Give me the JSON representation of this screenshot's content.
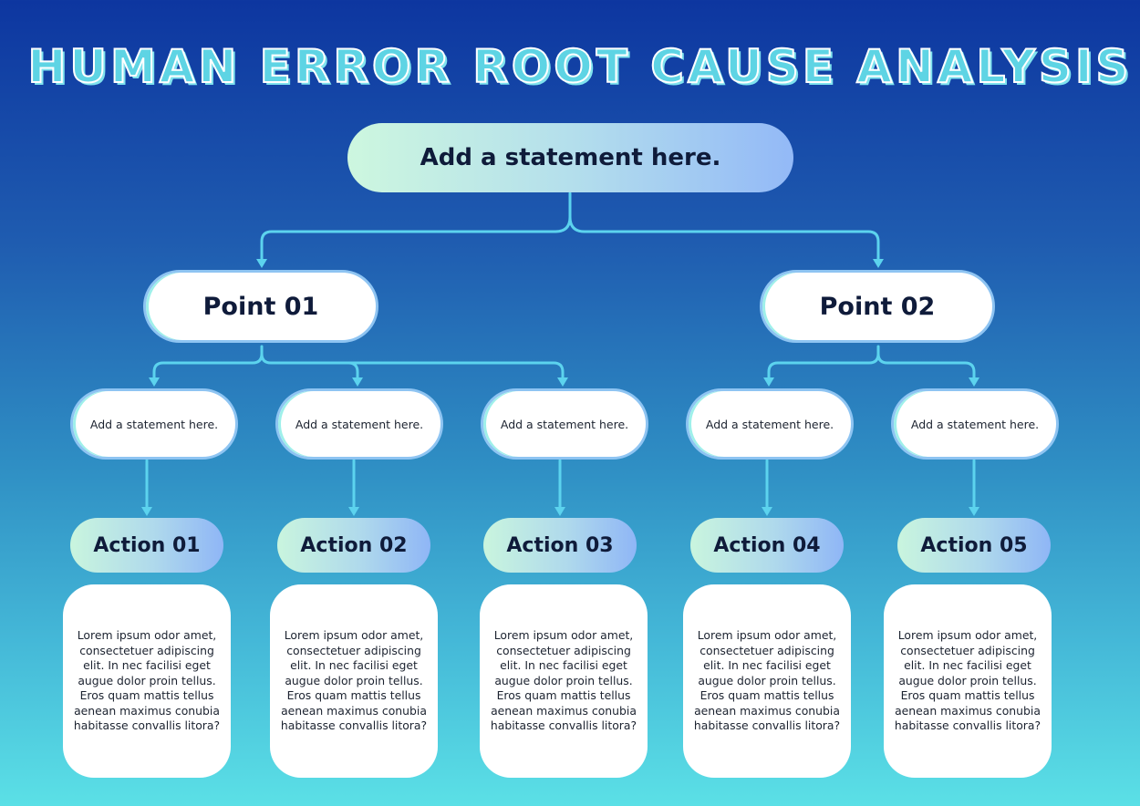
{
  "title": "HUMAN ERROR ROOT CAUSE ANALYSIS",
  "root": {
    "label": "Add a statement here."
  },
  "points": [
    {
      "label": "Point 01"
    },
    {
      "label": "Point 02"
    }
  ],
  "branches": [
    {
      "point": 1,
      "statement": "Add a statement here.",
      "action": "Action 01",
      "description": "Lorem ipsum odor amet, consectetuer adipiscing elit. In nec facilisi eget augue dolor proin tellus. Eros quam mattis tellus aenean maximus conubia habitasse convallis litora?"
    },
    {
      "point": 1,
      "statement": "Add a statement here.",
      "action": "Action 02",
      "description": "Lorem ipsum odor amet, consectetuer adipiscing elit. In nec facilisi eget augue dolor proin tellus. Eros quam mattis tellus aenean maximus conubia habitasse convallis litora?"
    },
    {
      "point": 1,
      "statement": "Add a statement here.",
      "action": "Action 03",
      "description": "Lorem ipsum odor amet, consectetuer adipiscing elit. In nec facilisi eget augue dolor proin tellus. Eros quam mattis tellus aenean maximus conubia habitasse convallis litora?"
    },
    {
      "point": 2,
      "statement": "Add a statement here.",
      "action": "Action 04",
      "description": "Lorem ipsum odor amet, consectetuer adipiscing elit. In nec facilisi eget augue dolor proin tellus. Eros quam mattis tellus aenean maximus conubia habitasse convallis litora?"
    },
    {
      "point": 2,
      "statement": "Add a statement here.",
      "action": "Action 05",
      "description": "Lorem ipsum odor amet, consectetuer adipiscing elit. In nec facilisi eget augue dolor proin tellus. Eros quam mattis tellus aenean maximus conubia habitasse convallis litora?"
    }
  ],
  "colors": {
    "background_top": "#0d36a0",
    "background_bottom": "#5be0e6",
    "connector": "#5cd3ee",
    "text_dark": "#0f1b3a",
    "pill_border": "#8ec4f2"
  }
}
